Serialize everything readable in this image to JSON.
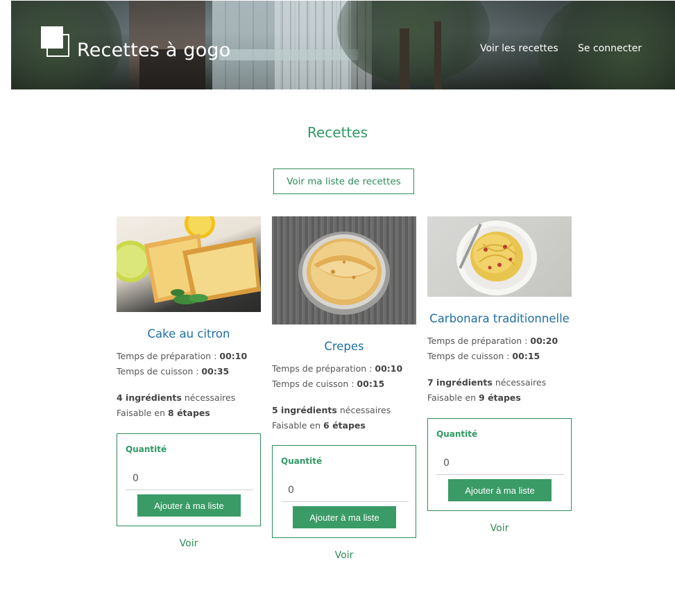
{
  "header": {
    "brand": "Recettes à gogo",
    "nav": [
      "Voir les recettes",
      "Se connecter"
    ]
  },
  "main": {
    "title": "Recettes",
    "list_button": "Voir ma liste de recettes"
  },
  "labels": {
    "prep": "Temps de préparation : ",
    "cook": "Temps de cuisson : ",
    "ingredients_suffix": " nécessaires",
    "steps_prefix": "Faisable en ",
    "quantity": "Quantité",
    "add": "Ajouter à ma liste",
    "view": "Voir"
  },
  "recipes": [
    {
      "name": "Cake au citron",
      "prep": "00:10",
      "cook": "00:35",
      "ingredients": "4 ingrédients",
      "steps": "8 étapes",
      "quantity": "0"
    },
    {
      "name": "Crepes",
      "prep": "00:10",
      "cook": "00:15",
      "ingredients": "5 ingrédients",
      "steps": "6 étapes",
      "quantity": "0"
    },
    {
      "name": "Carbonara traditionnelle",
      "prep": "00:20",
      "cook": "00:15",
      "ingredients": "7 ingrédients",
      "steps": "9 étapes",
      "quantity": "0"
    }
  ],
  "colors": {
    "accent": "#2e8b57",
    "title_blue": "#1f6fa5"
  }
}
